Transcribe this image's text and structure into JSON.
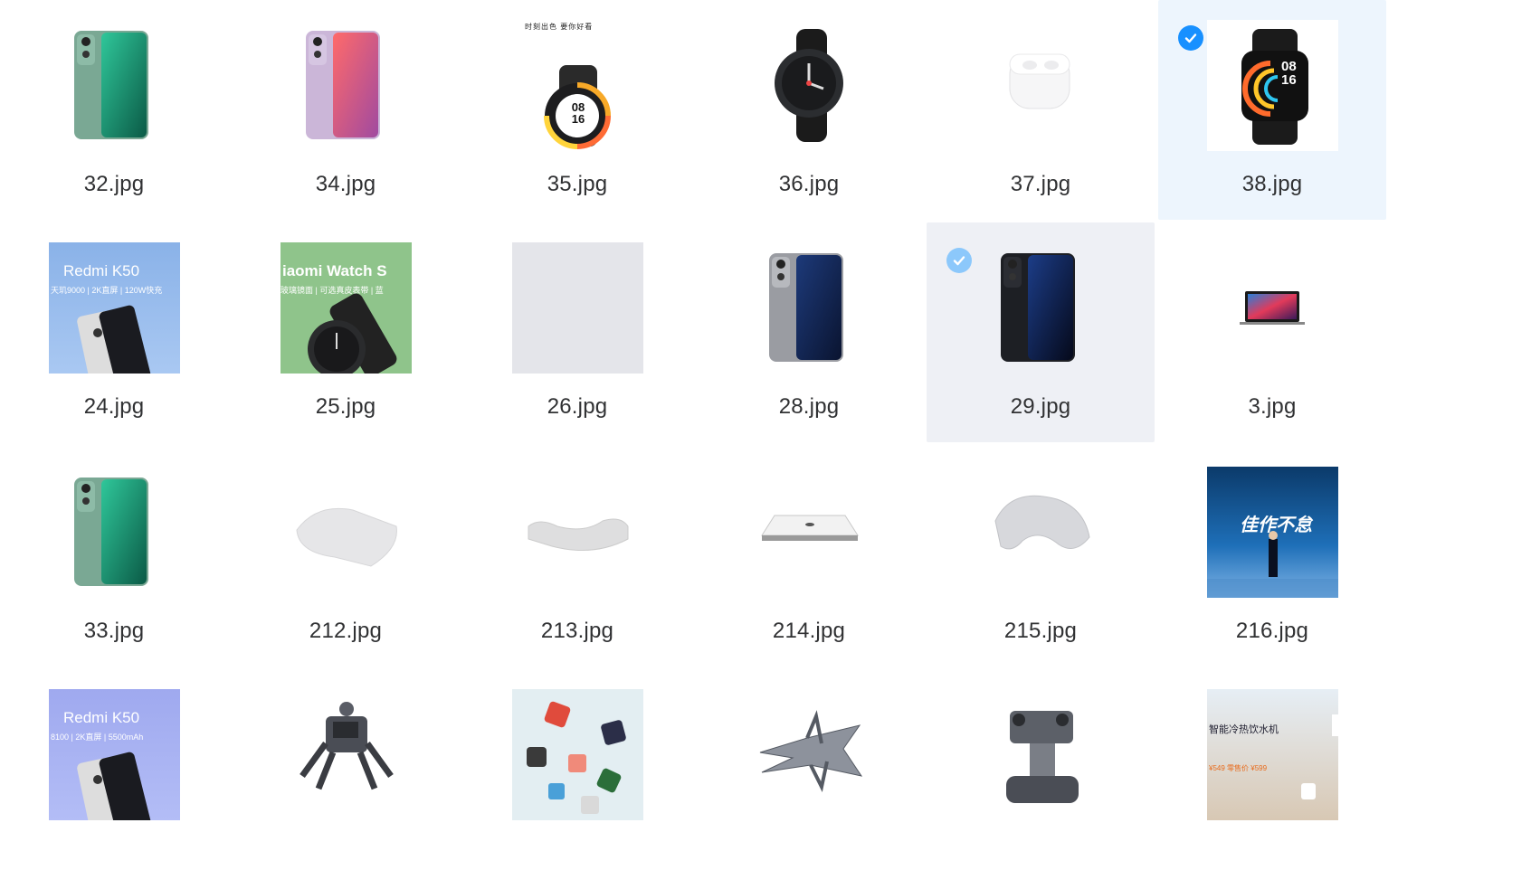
{
  "gallery": {
    "items": [
      {
        "filename": "32.jpg",
        "thumb": "phone-green",
        "selected": "none"
      },
      {
        "filename": "34.jpg",
        "thumb": "phone-purple",
        "selected": "none"
      },
      {
        "filename": "35.jpg",
        "thumb": "watch-banner",
        "selected": "none",
        "banner_text": "时刻出色  要你好看",
        "watch_time": [
          "08",
          "16"
        ]
      },
      {
        "filename": "36.jpg",
        "thumb": "watch-black",
        "selected": "none"
      },
      {
        "filename": "37.jpg",
        "thumb": "earbuds",
        "selected": "none"
      },
      {
        "filename": "38.jpg",
        "thumb": "smartwatch",
        "selected": "bright",
        "watch_time": [
          "08",
          "16"
        ]
      },
      {
        "filename": "24.jpg",
        "thumb": "k50-blue",
        "selected": "none",
        "banner_title": "Redmi K50",
        "banner_sub": "天玑9000 | 2K直屏 | 120W快充"
      },
      {
        "filename": "25.jpg",
        "thumb": "watch-green-banner",
        "selected": "none",
        "banner_title": "iaomi  Watch S",
        "banner_sub": "玻璃镜面 | 可选真皮表带 | 蓝"
      },
      {
        "filename": "26.jpg",
        "thumb": "blank",
        "selected": "none"
      },
      {
        "filename": "28.jpg",
        "thumb": "phone-silver",
        "selected": "none"
      },
      {
        "filename": "29.jpg",
        "thumb": "phone-black",
        "selected": "gray"
      },
      {
        "filename": "3.jpg",
        "thumb": "laptop",
        "selected": "none"
      },
      {
        "filename": "33.jpg",
        "thumb": "phone-green",
        "selected": "none"
      },
      {
        "filename": "212.jpg",
        "thumb": "pillow-flat",
        "selected": "none"
      },
      {
        "filename": "213.jpg",
        "thumb": "pillow-wave",
        "selected": "none"
      },
      {
        "filename": "214.jpg",
        "thumb": "scale",
        "selected": "none"
      },
      {
        "filename": "215.jpg",
        "thumb": "pillow-u",
        "selected": "none"
      },
      {
        "filename": "216.jpg",
        "thumb": "stage",
        "selected": "none",
        "banner_title": "佳作不怠"
      },
      {
        "filename": "",
        "thumb": "k50-purple",
        "selected": "none",
        "banner_title": "Redmi K50",
        "banner_sub": "8100 | 2K直屏 | 5500mAh"
      },
      {
        "filename": "",
        "thumb": "robot-spider",
        "selected": "none"
      },
      {
        "filename": "",
        "thumb": "cubes",
        "selected": "none"
      },
      {
        "filename": "",
        "thumb": "jet",
        "selected": "none"
      },
      {
        "filename": "",
        "thumb": "robot-tank",
        "selected": "none"
      },
      {
        "filename": "",
        "thumb": "dispenser",
        "selected": "none",
        "banner_title": "智能冷热饮水机",
        "banner_sub": "¥549  零售价 ¥599"
      }
    ]
  },
  "colors": {
    "selected_bright": "#edf5fd",
    "selected_gray": "#eef0f5",
    "check_blue": "#1890ff",
    "text": "#303133"
  }
}
